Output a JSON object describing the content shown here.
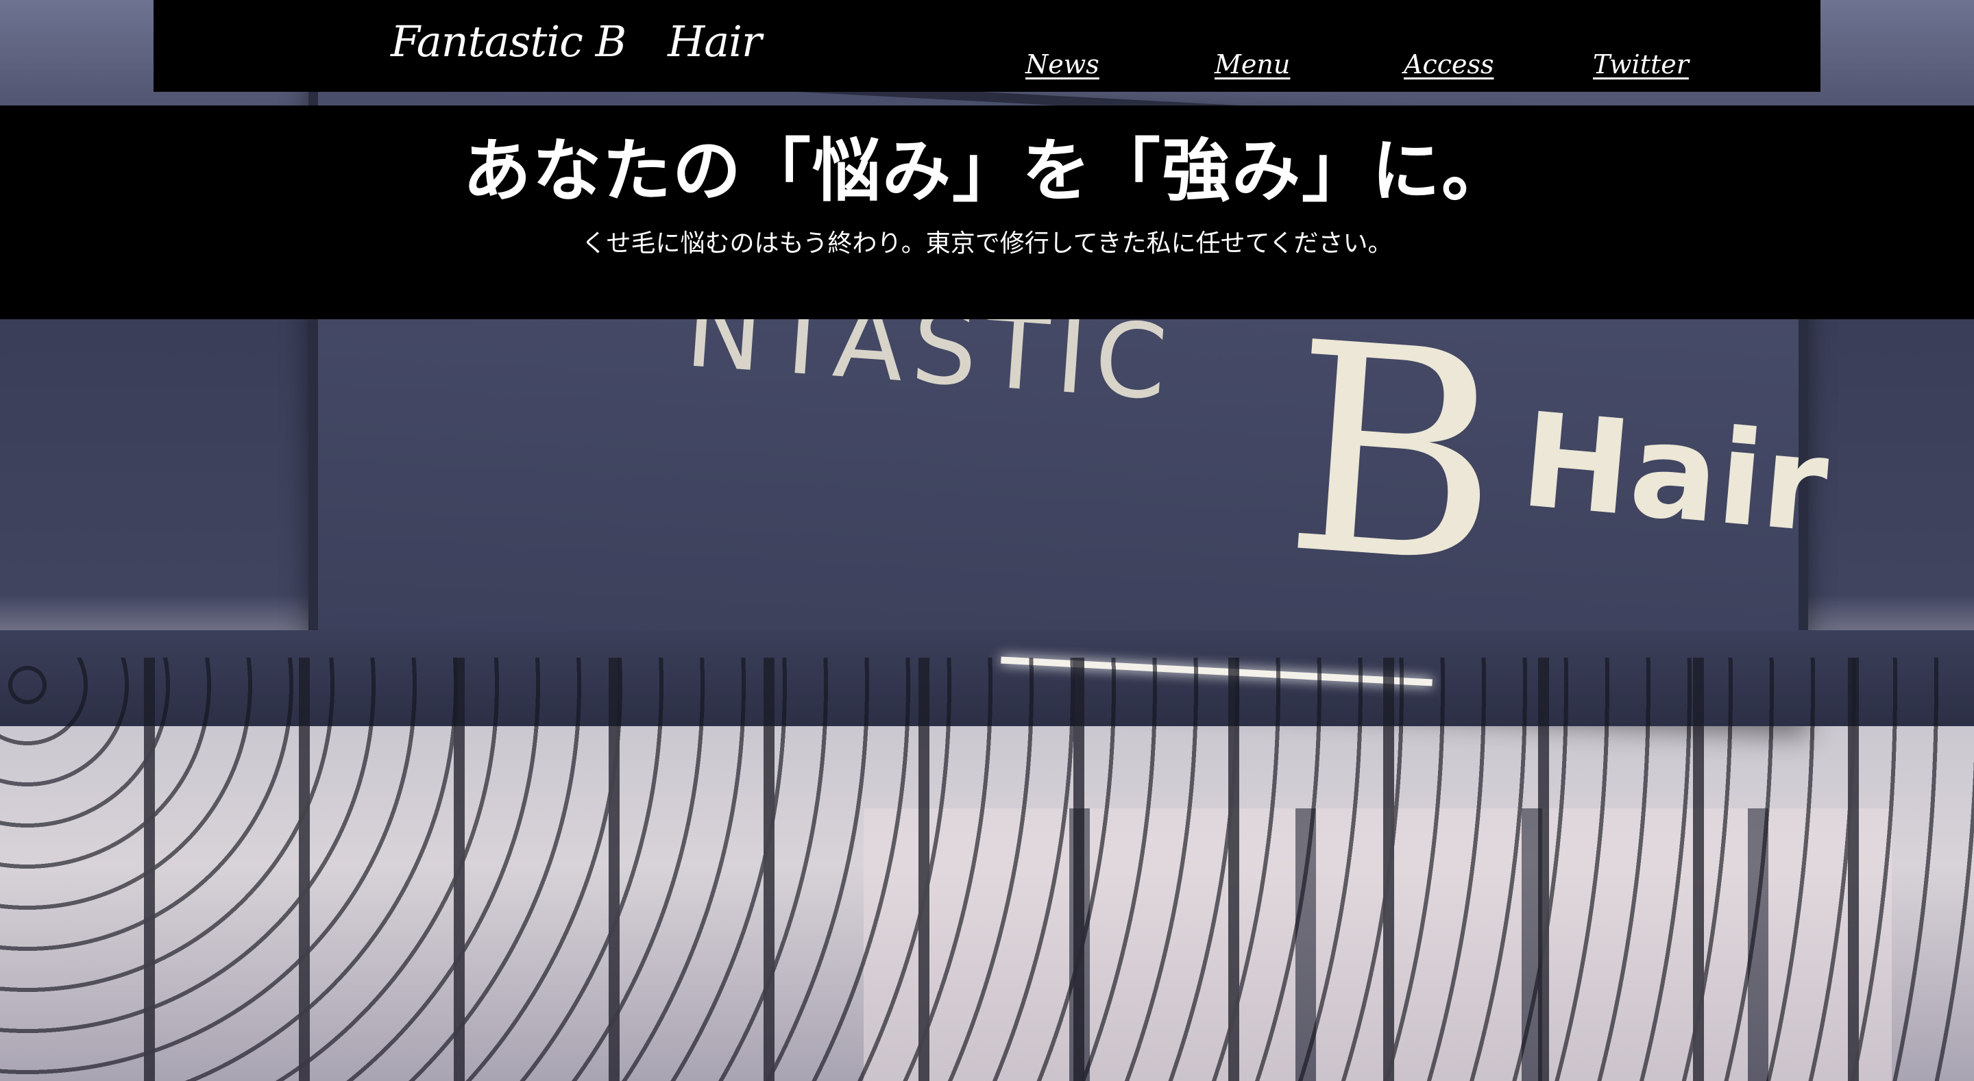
{
  "header": {
    "site_title": "Fantastic B　Hair",
    "nav": [
      {
        "label": "News"
      },
      {
        "label": "Menu"
      },
      {
        "label": "Access"
      },
      {
        "label": "Twitter"
      }
    ]
  },
  "hero": {
    "headline": "あなたの「悩み」を「強み」に。",
    "subtext": "くせ毛に悩むのはもう終わり。東京で修行してきた私に任せてください。"
  },
  "background_photo": {
    "sign_text_partial": "NTASTIC",
    "sign_letter": "B",
    "sign_word": "Hair"
  },
  "colors": {
    "bar_background": "#000000",
    "text": "#ffffff"
  }
}
